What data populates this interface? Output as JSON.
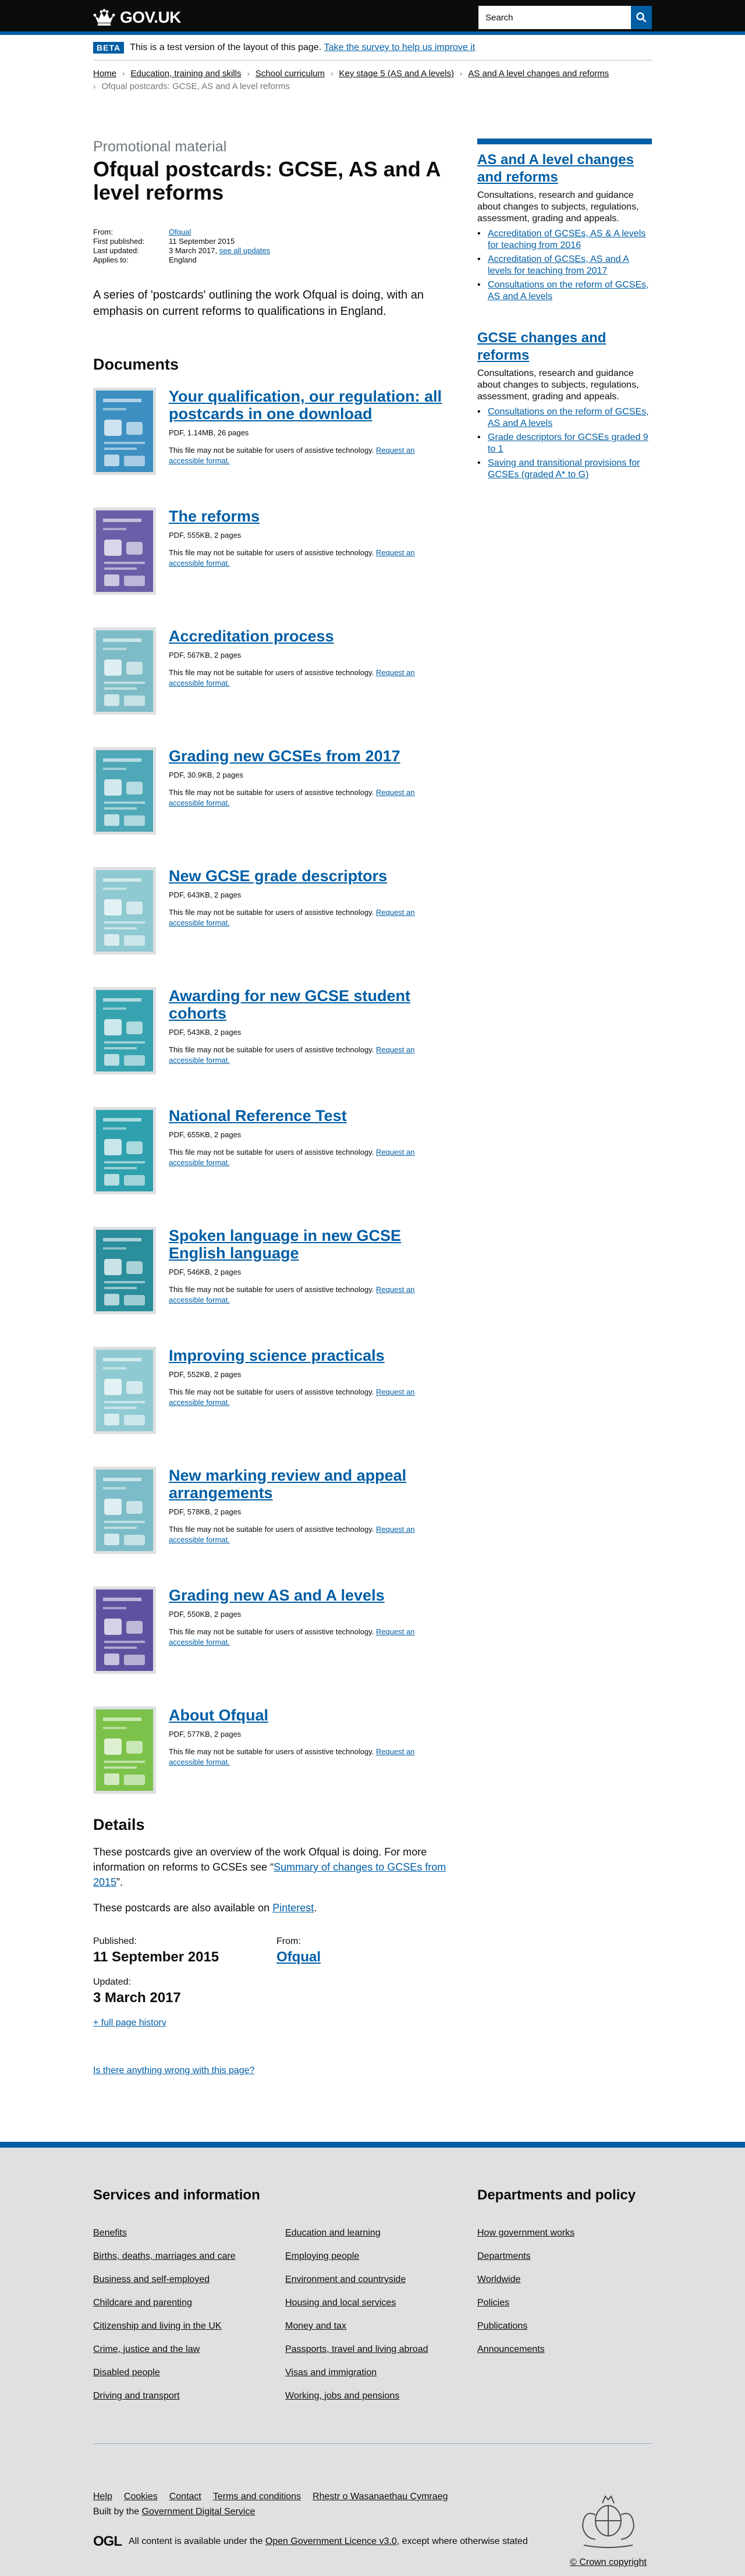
{
  "header": {
    "logo_text": "GOV.UK",
    "search_placeholder": "Search"
  },
  "beta": {
    "tag": "BETA",
    "message": "This is a test version of the layout of this page.",
    "link": "Take the survey to help us improve it"
  },
  "breadcrumbs": [
    {
      "label": "Home"
    },
    {
      "label": "Education, training and skills"
    },
    {
      "label": "School curriculum"
    },
    {
      "label": "Key stage 5 (AS and A levels)"
    },
    {
      "label": "AS and A level changes and reforms"
    }
  ],
  "breadcrumb_current": "Ofqual postcards: GCSE, AS and A level reforms",
  "page": {
    "kicker": "Promotional material",
    "title": "Ofqual postcards: GCSE, AS and A level reforms",
    "meta": {
      "from_label": "From:",
      "from_value": "Ofqual",
      "first_label": "First published:",
      "first_value": "11 September 2015",
      "last_label": "Last updated:",
      "last_value": "3 March 2017,",
      "last_link": "see all updates",
      "applies_label": "Applies to:",
      "applies_value": "England"
    },
    "lead": "A series of 'postcards' outlining the work Ofqual is doing, with an emphasis on current reforms to qualifications in England.",
    "documents_heading": "Documents"
  },
  "documents": [
    {
      "title": "Your qualification, our regulation: all postcards in one download",
      "meta": "PDF, 1.14MB, 26 pages",
      "thumb_color": "#3d8fc2"
    },
    {
      "title": "The reforms",
      "meta": "PDF, 555KB, 2 pages",
      "thumb_color": "#6b5ea8"
    },
    {
      "title": "Accreditation process",
      "meta": "PDF, 567KB, 2 pages",
      "thumb_color": "#7dbcc6"
    },
    {
      "title": "Grading new GCSEs from 2017",
      "meta": "PDF, 30.9KB, 2 pages",
      "thumb_color": "#4fa8b8"
    },
    {
      "title": "New GCSE grade descriptors",
      "meta": "PDF, 643KB, 2 pages",
      "thumb_color": "#8fc9d2"
    },
    {
      "title": "Awarding for new GCSE student cohorts",
      "meta": "PDF, 543KB, 2 pages",
      "thumb_color": "#38a3b0"
    },
    {
      "title": "National Reference Test",
      "meta": "PDF, 655KB, 2 pages",
      "thumb_color": "#2fa0ad"
    },
    {
      "title": "Spoken language in new GCSE English language",
      "meta": "PDF, 546KB, 2 pages",
      "thumb_color": "#2a8e9c"
    },
    {
      "title": "Improving science practicals",
      "meta": "PDF, 552KB, 2 pages",
      "thumb_color": "#8fcad3"
    },
    {
      "title": "New marking review and appeal arrangements",
      "meta": "PDF, 578KB, 2 pages",
      "thumb_color": "#7bbcc8"
    },
    {
      "title": "Grading new AS and A levels",
      "meta": "PDF, 550KB, 2 pages",
      "thumb_color": "#6050a0"
    },
    {
      "title": "About Ofqual",
      "meta": "PDF, 577KB, 2 pages",
      "thumb_color": "#7cc24a"
    }
  ],
  "doc_note": {
    "text": "This file may not be suitable for users of assistive technology.",
    "link": "Request an accessible format."
  },
  "details": {
    "heading": "Details",
    "p1_before": "These postcards give an overview of the work Ofqual is doing. For more information on reforms to GCSEs see “",
    "p1_link": "Summary of changes to GCSEs from 2015",
    "p1_after": "”.",
    "p2_before": "These postcards are also available on ",
    "p2_link": "Pinterest",
    "p2_after": ".",
    "published_label": "Published:",
    "published_value": "11 September 2015",
    "from_label": "From:",
    "from_value": "Ofqual",
    "updated_label": "Updated:",
    "updated_value": "3 March 2017",
    "history_link": "+ full page history",
    "wrong_link": "Is there anything wrong with this page?"
  },
  "sidebar": [
    {
      "title": "AS and A level changes and reforms",
      "desc": "Consultations, research and guidance about changes to subjects, regulations, assessment, grading and appeals.",
      "links": [
        "Accreditation of GCSEs, AS & A levels for teaching from 2016",
        "Accreditation of GCSEs, AS and A levels for teaching from 2017",
        "Consultations on the reform of GCSEs, AS and A levels"
      ]
    },
    {
      "title": "GCSE changes and reforms",
      "desc": "Consultations, research and guidance about changes to subjects, regulations, assessment, grading and appeals.",
      "links": [
        "Consultations on the reform of GCSEs, AS and A levels",
        "Grade descriptors for GCSEs graded 9 to 1",
        "Saving and transitional provisions for GCSEs (graded A* to G)"
      ]
    }
  ],
  "footer": {
    "services_title": "Services and information",
    "departments_title": "Departments and policy",
    "services_col1": [
      "Benefits",
      "Births, deaths, marriages and care",
      "Business and self-employed",
      "Childcare and parenting",
      "Citizenship and living in the UK",
      "Crime, justice and the law",
      "Disabled people",
      "Driving and transport"
    ],
    "services_col2": [
      "Education and learning",
      "Employing people",
      "Environment and countryside",
      "Housing and local services",
      "Money and tax",
      "Passports, travel and living abroad",
      "Visas and immigration",
      "Working, jobs and pensions"
    ],
    "departments": [
      "How government works",
      "Departments",
      "Worldwide",
      "Policies",
      "Publications",
      "Announcements"
    ],
    "meta_links": [
      "Help",
      "Cookies",
      "Contact",
      "Terms and conditions",
      "Rhestr o Wasanaethau Cymraeg"
    ],
    "built_before": "Built by the ",
    "built_link": "Government Digital Service",
    "ogl": "OGL",
    "licence_before": "All content is available under the ",
    "licence_link": "Open Government Licence v3.0",
    "licence_after": ", except where otherwise stated",
    "copyright": "© Crown copyright"
  },
  "colors": {
    "brand_blue": "#005ea5",
    "text": "#0b0c0c",
    "secondary": "#6f777b",
    "footer_bg": "#dee0e2"
  }
}
